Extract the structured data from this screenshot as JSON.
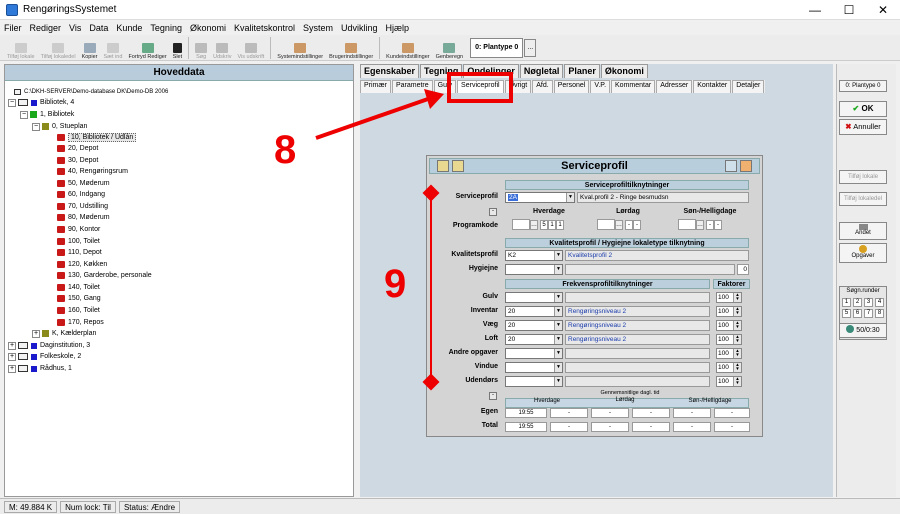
{
  "window": {
    "title": "RengøringsSystemet",
    "controls": [
      "—",
      "☐",
      "✕"
    ]
  },
  "menu": [
    "Filer",
    "Rediger",
    "Vis",
    "Data",
    "Kunde",
    "Tegning",
    "Økonomi",
    "Kvalitetskontrol",
    "System",
    "Udvikling",
    "Hjælp"
  ],
  "toolbar": {
    "buttons": [
      {
        "label": "Tilføj lokale",
        "enabled": false
      },
      {
        "label": "Tilføj lokaledel",
        "enabled": false
      },
      {
        "label": "Kopier",
        "enabled": true
      },
      {
        "label": "Sæt ind",
        "enabled": false
      },
      {
        "label": "Fortryd Rediger",
        "enabled": true
      },
      {
        "label": "Slet",
        "enabled": true
      },
      {
        "label": "Søg",
        "enabled": false
      },
      {
        "label": "Udskriv",
        "enabled": false
      },
      {
        "label": "Vis udskrift",
        "enabled": false
      },
      {
        "label": "Systemindstillinger",
        "enabled": true
      },
      {
        "label": "Brugerindstillinger",
        "enabled": true
      },
      {
        "label": "Kundeindstillinger",
        "enabled": true
      },
      {
        "label": "Genberegn",
        "enabled": true
      }
    ],
    "plantype": "0: Plantype 0",
    "plantype_btn": "..."
  },
  "tree": {
    "header": "Hoveddata",
    "path": "C:\\DKH-SERVER\\Demo-database DK\\Demo-DB 2006",
    "items": [
      {
        "label": "Bibliotek, 4"
      },
      {
        "label": "1, Bibliotek"
      },
      {
        "label": "0, Stueplan"
      },
      {
        "label": "10, Bibliotek / Udlån"
      },
      {
        "label": "20, Depot"
      },
      {
        "label": "30, Depot"
      },
      {
        "label": "40, Rengøringsrum"
      },
      {
        "label": "50, Møderum"
      },
      {
        "label": "60, Indgang"
      },
      {
        "label": "70, Udstilling"
      },
      {
        "label": "80, Møderum"
      },
      {
        "label": "90, Kontor"
      },
      {
        "label": "100, Toilet"
      },
      {
        "label": "110, Depot"
      },
      {
        "label": "120, Køkken"
      },
      {
        "label": "130, Garderobe, personale"
      },
      {
        "label": "140, Toilet"
      },
      {
        "label": "150, Gang"
      },
      {
        "label": "160, Toilet"
      },
      {
        "label": "170, Repos"
      },
      {
        "label": "K, Kælderplan"
      },
      {
        "label": "Daginstitution, 3"
      },
      {
        "label": "Folkeskole, 2"
      },
      {
        "label": "Rådhus, 1"
      }
    ]
  },
  "tabs_main": [
    "Egenskaber",
    "Tegning",
    "Opdelinger",
    "Nøgletal",
    "Planer",
    "Økonomi"
  ],
  "tabs_sub": [
    "Primær",
    "Parametre",
    "Gulv",
    "Serviceprofil",
    "Øvrigt",
    "Afd.",
    "Personel",
    "V.P.",
    "Kommentar",
    "Adresser",
    "Kontakter",
    "Detaljer"
  ],
  "dialog": {
    "title": "Serviceprofil",
    "sec_tilknytning": "Serviceprofiltilknytninger",
    "serviceprofil_label": "Serviceprofil",
    "serviceprofil_value": "2A",
    "serviceprofil_desc": "Kval.profil 2 - Ringe besmudsn",
    "hverdage": "Hverdage",
    "lordag": "Lørdag",
    "sondag": "Søn-/Helligdage",
    "programkode_label": "Programkode",
    "pk_hverdage": [
      "5",
      "1",
      "1"
    ],
    "pk_lordag": [
      "-",
      "-"
    ],
    "pk_sondag": [
      "-",
      "-"
    ],
    "sec_kvalitet": "Kvalitetsprofil / Hygiejne lokaletype tilknytning",
    "kvalitet_label": "Kvalitetsprofil",
    "kvalitet_value": "K2",
    "kvalitet_desc": "Kvalitetsprofil 2",
    "hygiejne_label": "Hygiejne",
    "hygiejne_num": "0",
    "sec_frekvens": "Frekvensprofiltilknytninger",
    "faktorer": "Faktorer",
    "rows": [
      {
        "label": "Gulv",
        "value": "",
        "desc": "",
        "factor": "100"
      },
      {
        "label": "Inventar",
        "value": "20",
        "desc": "Rengøringsniveau 2",
        "factor": "100"
      },
      {
        "label": "Væg",
        "value": "20",
        "desc": "Rengøringsniveau 2",
        "factor": "100"
      },
      {
        "label": "Loft",
        "value": "20",
        "desc": "Rengøringsniveau 2",
        "factor": "100"
      },
      {
        "label": "Andre opgaver",
        "value": "",
        "desc": "",
        "factor": "100"
      },
      {
        "label": "Vindue",
        "value": "",
        "desc": "",
        "factor": "100"
      },
      {
        "label": "Udendørs",
        "value": "",
        "desc": "",
        "factor": "100"
      }
    ],
    "gennemsnit": "Gennemsnitlige dagl. tid",
    "g_hverdage": "Hverdage",
    "g_lordag": "Lørdag",
    "g_sondag": "Søn-/Helligdage",
    "egen_label": "Egen",
    "total_label": "Total",
    "egen": [
      "19:55",
      "-",
      "-",
      "-",
      "-",
      "-"
    ],
    "total": [
      "19:55",
      "-",
      "-",
      "-",
      "-",
      "-"
    ]
  },
  "side": {
    "plantype": "0: Plantype 0",
    "ok": "OK",
    "annuller": "Annuller",
    "tilfoj_lokale": "Tilføj lokale",
    "tilfoj_lokaledel": "Tilføj lokaledel",
    "andet": "Andet",
    "opgaver": "Opgaver",
    "soeg_runder": "Søgn.runder",
    "runder": [
      "1",
      "2",
      "3",
      "4",
      "5",
      "6",
      "7",
      "8"
    ],
    "counter": "50/0:30"
  },
  "status": [
    "M: 49.884 K",
    "Num lock: Til",
    "Status: Ændre"
  ],
  "annotations": {
    "a8": "8",
    "a9": "9"
  }
}
